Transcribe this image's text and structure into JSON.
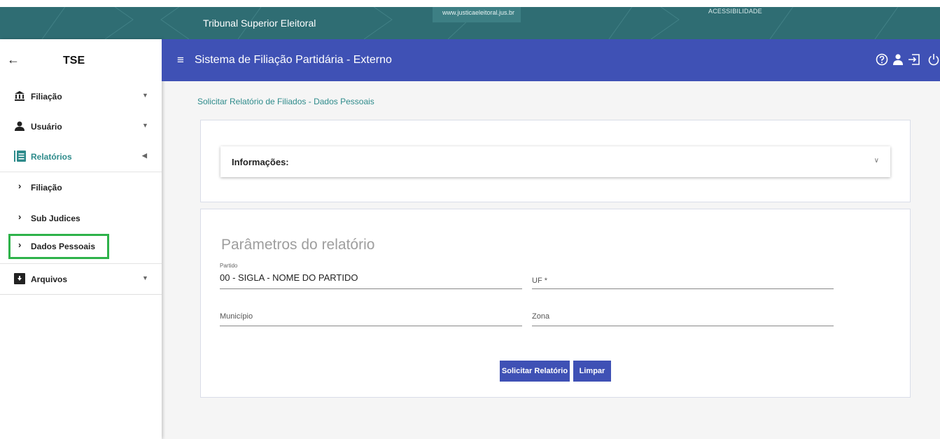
{
  "banner": {
    "title": "Tribunal Superior Eleitoral",
    "url": "www.justicaeleitoral.jus.br",
    "accessibility": "ACESSIBILIDADE"
  },
  "sidebar": {
    "brand": "TSE",
    "back_icon": "arrow-left-icon",
    "items": [
      {
        "label": "Filiação",
        "icon": "bank-icon"
      },
      {
        "label": "Usuário",
        "icon": "person-icon"
      },
      {
        "label": "Relatórios",
        "icon": "report-icon"
      }
    ],
    "sub_items": [
      {
        "label": "Filiação"
      },
      {
        "label": "Sub Judices"
      },
      {
        "label": "Dados Pessoais"
      }
    ],
    "archive": {
      "label": "Arquivos",
      "icon": "archive-icon"
    }
  },
  "appbar": {
    "title": "Sistema de Filiação Partidária - Externo",
    "icons": [
      "help-icon",
      "user-icon",
      "logout-icon",
      "power-icon"
    ]
  },
  "breadcrumb": "Solicitar Relatório de Filiados - Dados Pessoais",
  "info_panel": {
    "label": "Informações:"
  },
  "form": {
    "title": "Parâmetros do relatório",
    "partido_label": "Partido",
    "partido_value": "00 - SIGLA - NOME DO PARTIDO",
    "uf_placeholder": "UF *",
    "municipio_placeholder": "Município",
    "zona_placeholder": "Zona",
    "submit_label": "Solicitar Relatório",
    "clear_label": "Limpar"
  },
  "colors": {
    "banner": "#2f6d73",
    "appbar": "#3f51b5",
    "accent": "#2e8b8b",
    "highlight": "#2eb24a"
  }
}
